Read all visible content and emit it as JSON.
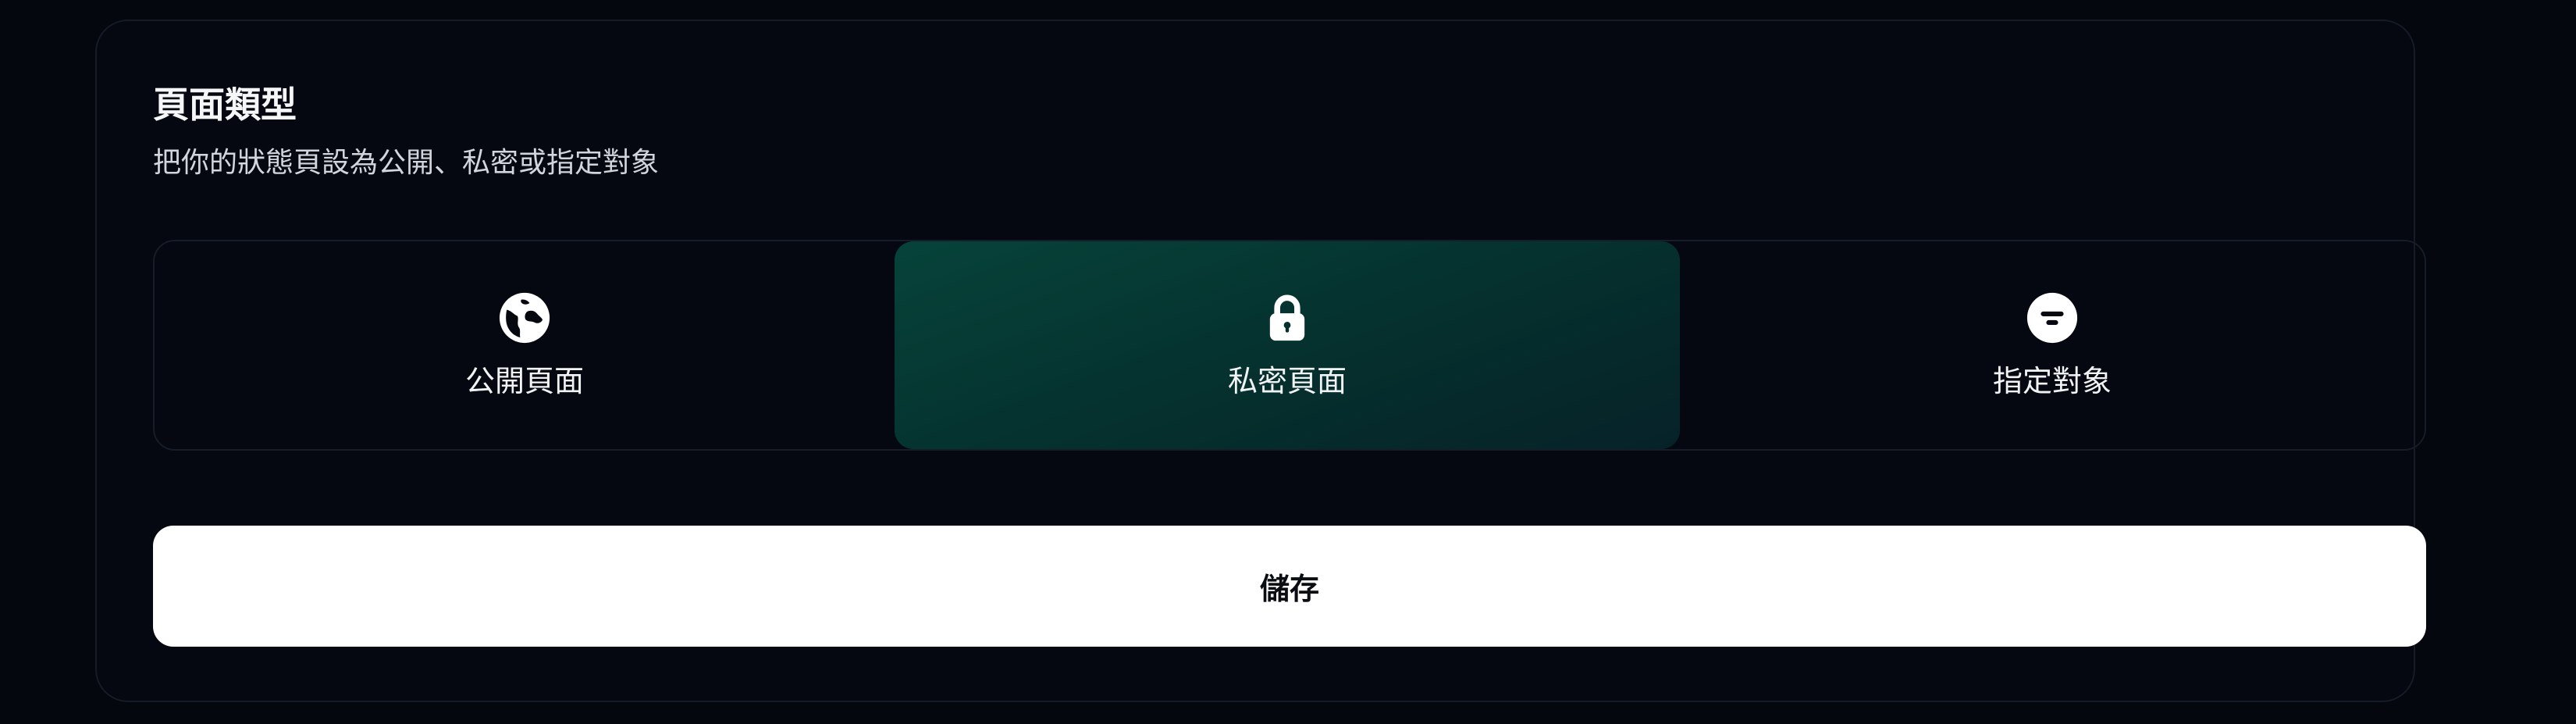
{
  "section": {
    "title": "頁面類型",
    "subtitle": "把你的狀態頁設為公開、私密或指定對象"
  },
  "visibility_options": [
    {
      "label": "公開頁面",
      "icon": "globe-icon",
      "selected": false
    },
    {
      "label": "私密頁面",
      "icon": "lock-icon",
      "selected": true
    },
    {
      "label": "指定對象",
      "icon": "audience-icon",
      "selected": false
    }
  ],
  "actions": {
    "save_label": "儲存"
  },
  "colors": {
    "background": "#04070d",
    "selected_option": "#05302d",
    "button": "#ffffff",
    "text": "#f1f3f5"
  }
}
